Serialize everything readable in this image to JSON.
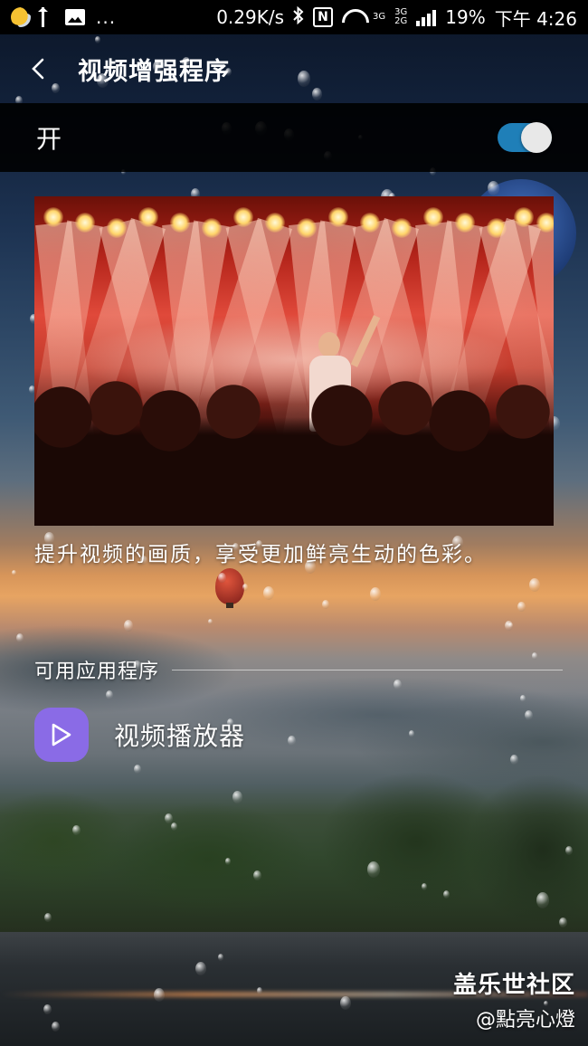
{
  "status_bar": {
    "more_indicator": "...",
    "network_speed": "0.29K/s",
    "nfc_label": "N",
    "net_type_top": "3G",
    "net_type_bottom": "3G",
    "net_type_2g": "2G",
    "battery": "19%",
    "time": "下午 4:26"
  },
  "app_bar": {
    "title": "视频增强程序"
  },
  "master_switch": {
    "label": "开",
    "enabled": true,
    "accent_color": "#1f7fb8"
  },
  "main": {
    "description": "提升视频的画质，享受更加鲜亮生动的色彩。",
    "section_header": "可用应用程序",
    "apps": [
      {
        "name": "视频播放器",
        "icon": "play-icon",
        "icon_color": "#8a6be6"
      }
    ]
  },
  "watermark": {
    "title": "盖乐世社区",
    "user": "@點亮心燈"
  }
}
